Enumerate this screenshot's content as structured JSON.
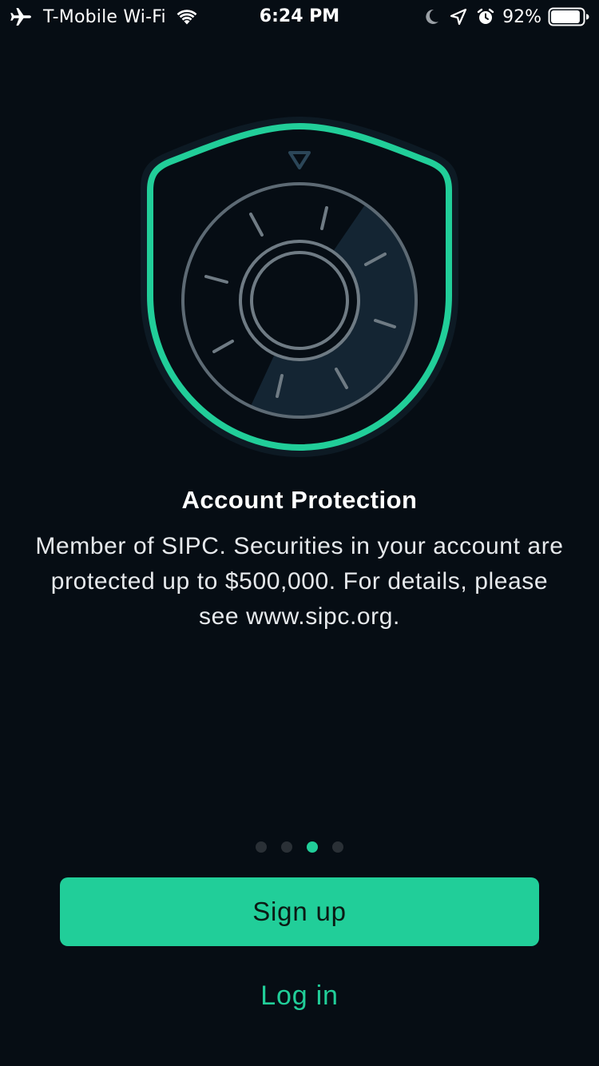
{
  "status_bar": {
    "carrier": "T-Mobile Wi-Fi",
    "time": "6:24 PM",
    "battery_percent": "92%",
    "battery_level": 0.92,
    "icons": [
      "airplane-icon",
      "wifi-icon",
      "moon-icon",
      "location-icon",
      "alarm-icon",
      "battery-icon"
    ]
  },
  "onboarding": {
    "illustration": "shield-safe-dial",
    "title": "Account Protection",
    "description": "Member of SIPC. Securities in your account are protected up to $500,000. For details, please see www.sipc.org.",
    "page_count": 4,
    "active_page": 3
  },
  "actions": {
    "signup_label": "Sign up",
    "login_label": "Log in"
  },
  "colors": {
    "background": "#060d14",
    "accent": "#21ce99",
    "dot_inactive": "#2a3036"
  }
}
